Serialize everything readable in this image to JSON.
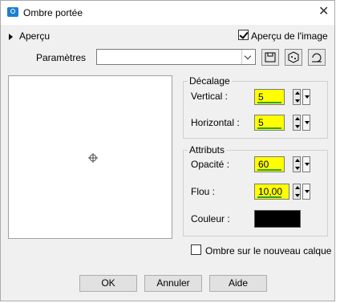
{
  "title": "Ombre portée",
  "close_glyph": "✕",
  "preview_toggle": "Aperçu",
  "preview_image_label": "Aperçu de l'image",
  "params_label": "Paramètres",
  "decalage": {
    "title": "Décalage",
    "vertical_label": "Vertical :",
    "vertical_value": "5",
    "horizontal_label": "Horizontal :",
    "horizontal_value": "5"
  },
  "attributs": {
    "title": "Attributs",
    "opacite_label": "Opacité :",
    "opacite_value": "60",
    "flou_label": "Flou :",
    "flou_value": "10,00",
    "couleur_label": "Couleur :",
    "couleur_value": "#000000"
  },
  "new_layer_label": "Ombre sur le nouveau calque",
  "buttons": {
    "ok": "OK",
    "cancel": "Annuler",
    "help": "Aide"
  },
  "colors": {
    "highlight": "#ffff00",
    "slider": "#2ea02e",
    "accent": "#1e7fd1"
  }
}
